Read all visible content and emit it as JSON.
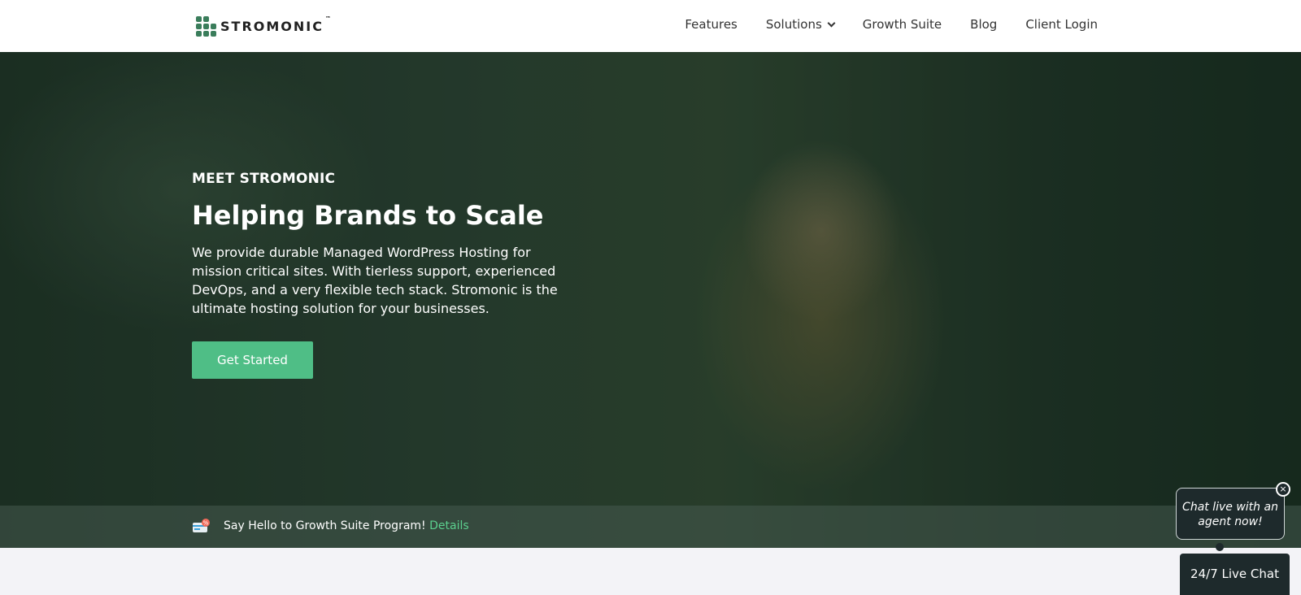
{
  "brand": {
    "name": "STROMONIC",
    "tm": "™",
    "accent": "#4fbe86"
  },
  "nav": {
    "features": "Features",
    "solutions": "Solutions",
    "growth_suite": "Growth Suite",
    "blog": "Blog",
    "client_login": "Client Login"
  },
  "hero": {
    "eyebrow": "MEET STROMONIC",
    "title": "Helping Brands to Scale",
    "description": "We provide durable Managed WordPress Hosting for mission critical sites. With tierless support, experienced DevOps, and a very flexible tech stack. Stromonic is the ultimate hosting solution for your businesses.",
    "cta_label": "Get Started"
  },
  "promo": {
    "text": "Say Hello to Growth Suite Program!",
    "link_label": "Details",
    "icon": "discount-card-icon"
  },
  "chat": {
    "bubble_text": "Chat live with an agent now!",
    "close_label": "×",
    "button_label": "24/7 Live Chat"
  }
}
